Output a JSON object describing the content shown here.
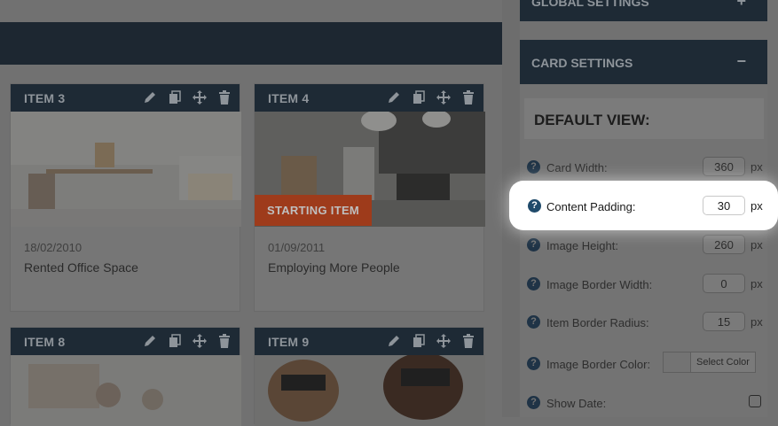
{
  "panel": {
    "global_settings": {
      "label": "GLOBAL SETTINGS",
      "toggle": "+"
    },
    "card_settings": {
      "label": "CARD SETTINGS",
      "toggle": "−"
    },
    "default_view": {
      "label": "DEFAULT VIEW:"
    },
    "fields": {
      "card_width": {
        "label": "Card Width:",
        "value": "360",
        "unit": "px"
      },
      "content_padding": {
        "label": "Content Padding:",
        "value": "30",
        "unit": "px"
      },
      "image_height": {
        "label": "Image Height:",
        "value": "260",
        "unit": "px"
      },
      "image_border_width": {
        "label": "Image Border Width:",
        "value": "0",
        "unit": "px"
      },
      "item_border_radius": {
        "label": "Item Border Radius:",
        "value": "15",
        "unit": "px"
      },
      "image_border_color": {
        "label": "Image Border Color:",
        "button": "Select Color"
      },
      "show_date": {
        "label": "Show Date:",
        "checked": false
      }
    },
    "help_icon_glyph": "?"
  },
  "cards": [
    {
      "title": "ITEM 3",
      "date": "18/02/2010",
      "caption": "Rented Office Space"
    },
    {
      "title": "ITEM 4",
      "badge": "STARTING ITEM",
      "date": "01/09/2011",
      "caption": "Employing More People"
    },
    {
      "title": "ITEM 8"
    },
    {
      "title": "ITEM 9"
    }
  ],
  "icons": [
    "pencil-icon",
    "copy-icon",
    "move-icon",
    "trash-icon",
    "help-icon"
  ],
  "colors": {
    "dark_header": "#1e2a35",
    "overlay": "#717171",
    "badge": "#9e3b1b",
    "help_icon": "#1f4a6a"
  }
}
